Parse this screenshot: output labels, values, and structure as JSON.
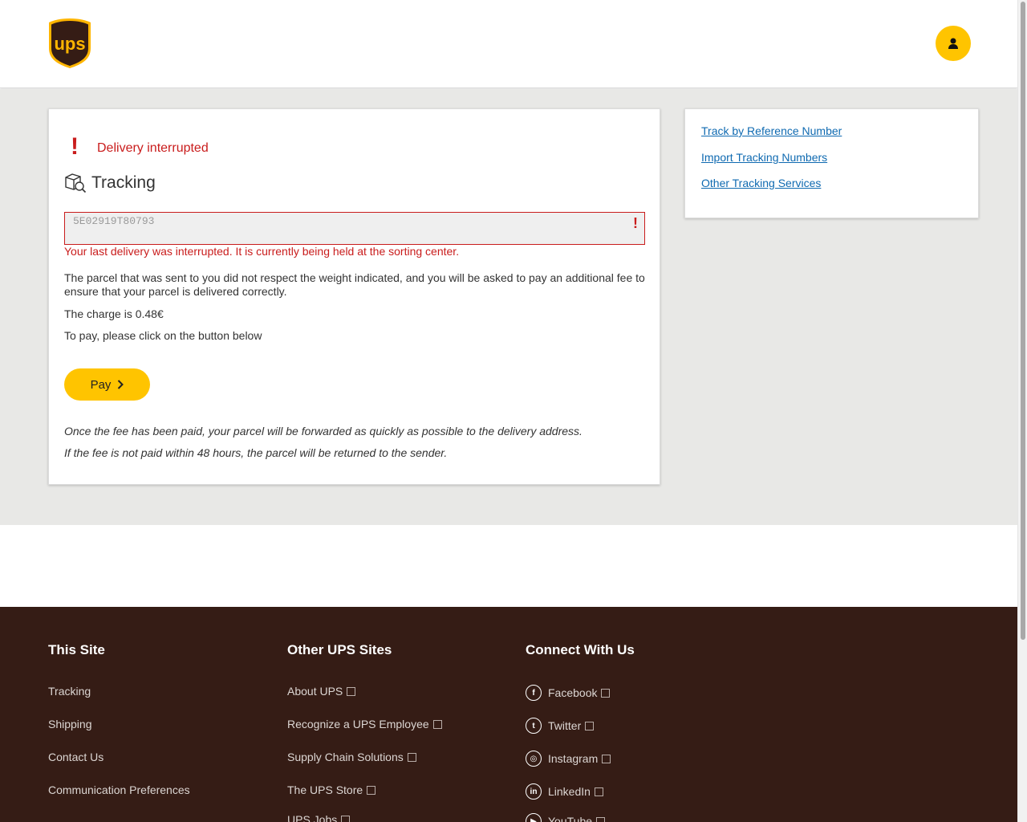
{
  "header": {
    "logo_text": "ups",
    "user_icon": "person-icon"
  },
  "alert": {
    "title": "Delivery interrupted",
    "icon": "exclamation-icon"
  },
  "tracking": {
    "title": "Tracking",
    "icon": "package-search-icon",
    "input_value": "5E02919T80793",
    "error_message": "Your last delivery was interrupted. It is currently being held at the sorting center.",
    "body_text": "The parcel that was sent to you did not respect the weight indicated, and you will be asked to pay an additional fee to ensure that your parcel is delivered correctly.",
    "charge_text": "The charge is 0.48€",
    "instruction_text": "To pay, please click on the button below",
    "pay_label": "Pay",
    "note_forwarded": "Once the fee has been paid, your parcel will be forwarded as quickly as possible to the delivery address.",
    "note_returned": "If the fee is not paid within 48 hours, the parcel will be returned to the sender."
  },
  "side_links": [
    "Track by Reference Number",
    "Import Tracking Numbers",
    "Other Tracking Services"
  ],
  "footer": {
    "this_site": {
      "title": "This Site",
      "items": [
        "Tracking",
        "Shipping",
        "Contact Us",
        "Communication Preferences"
      ]
    },
    "other_sites": {
      "title": "Other UPS Sites",
      "items": [
        "About UPS",
        "Recognize a UPS Employee",
        "Supply Chain Solutions",
        "The UPS Store",
        "UPS Jobs"
      ]
    },
    "connect": {
      "title": "Connect With Us",
      "items": [
        "Facebook",
        "Twitter",
        "Instagram",
        "LinkedIn",
        "YouTube"
      ]
    }
  },
  "colors": {
    "brand_yellow": "#ffc400",
    "brand_brown": "#351c15",
    "error_red": "#c91c1c",
    "link_blue": "#0f6ab1"
  }
}
